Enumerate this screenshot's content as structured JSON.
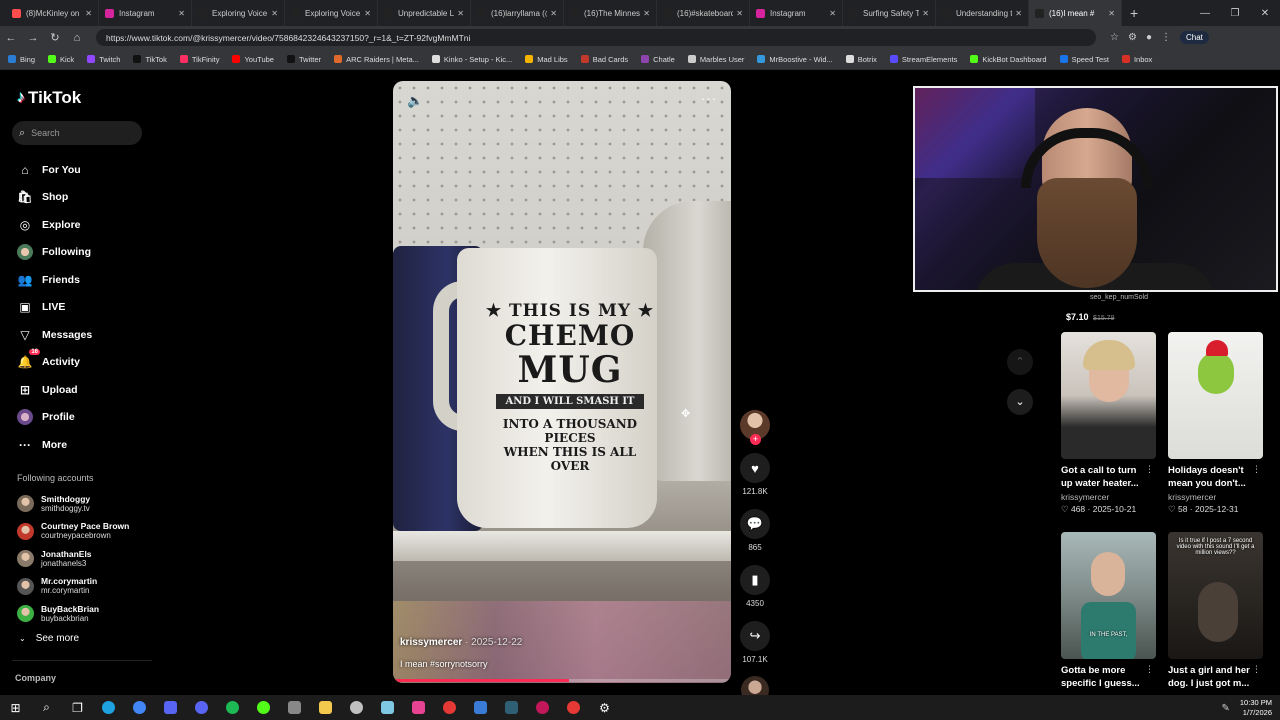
{
  "browser": {
    "tabs": [
      {
        "label": "(8)McKinley on K",
        "color": "#ff4d4d"
      },
      {
        "label": "Instagram",
        "color": "#d6249f"
      },
      {
        "label": "Exploring Voice A",
        "color": "#222222"
      },
      {
        "label": "Exploring Voice A",
        "color": "#222222"
      },
      {
        "label": "Unpredictable Lo",
        "color": "#222222"
      },
      {
        "label": "(16)larryllama (@",
        "color": "#222222"
      },
      {
        "label": "(16)The Minneso",
        "color": "#222222"
      },
      {
        "label": "(16)#skateboardi",
        "color": "#222222"
      },
      {
        "label": "Instagram",
        "color": "#d6249f"
      },
      {
        "label": "Surfing Safety Tip",
        "color": "#222222"
      },
      {
        "label": "Understanding th",
        "color": "#222222"
      },
      {
        "label": "(16)I mean #",
        "color": "#222222"
      }
    ],
    "url": "https://www.tiktok.com/@krissymercer/video/7586842324643237150?_r=1&_t=ZT-92fvgMmMTni",
    "chat_label": "Chat",
    "bookmarks": [
      {
        "label": "Bing",
        "color": "#2b7cd3"
      },
      {
        "label": "Kick",
        "color": "#53fc18"
      },
      {
        "label": "Twitch",
        "color": "#9146ff"
      },
      {
        "label": "TikTok",
        "color": "#111111"
      },
      {
        "label": "TikFinity",
        "color": "#ff2f66"
      },
      {
        "label": "YouTube",
        "color": "#ff0000"
      },
      {
        "label": "Twitter",
        "color": "#111111"
      },
      {
        "label": "ARC Raiders | Meta...",
        "color": "#e06a2b"
      },
      {
        "label": "Kinko - Setup - Kic...",
        "color": "#dddddd"
      },
      {
        "label": "Mad Libs",
        "color": "#f4b400"
      },
      {
        "label": "Bad Cards",
        "color": "#c0392b"
      },
      {
        "label": "Chatle",
        "color": "#8e44ad"
      },
      {
        "label": "Marbles User",
        "color": "#cccccc"
      },
      {
        "label": "MrBoostive - Wid...",
        "color": "#3498db"
      },
      {
        "label": "Botrix",
        "color": "#dddddd"
      },
      {
        "label": "StreamElements",
        "color": "#5a4bff"
      },
      {
        "label": "KickBot Dashboard",
        "color": "#53fc18"
      },
      {
        "label": "Speed Test",
        "color": "#1a73e8"
      },
      {
        "label": "Inbox",
        "color": "#d93025"
      }
    ]
  },
  "tiktok": {
    "logo": "TikTok",
    "search_placeholder": "Search",
    "nav": [
      {
        "label": "For You",
        "icon": "home-icon",
        "glyph": "⌂"
      },
      {
        "label": "Shop",
        "icon": "shop-icon",
        "glyph": "🛍"
      },
      {
        "label": "Explore",
        "icon": "compass-icon",
        "glyph": "◎"
      },
      {
        "label": "Following",
        "icon": "avatar",
        "glyph": ""
      },
      {
        "label": "Friends",
        "icon": "friends-icon",
        "glyph": "👥"
      },
      {
        "label": "LIVE",
        "icon": "live-icon",
        "glyph": "▣"
      },
      {
        "label": "Messages",
        "icon": "messages-icon",
        "glyph": "▽"
      },
      {
        "label": "Activity",
        "icon": "activity-icon",
        "glyph": "🔔",
        "badge": "16"
      },
      {
        "label": "Upload",
        "icon": "upload-icon",
        "glyph": "⊞"
      },
      {
        "label": "Profile",
        "icon": "avatar",
        "glyph": ""
      },
      {
        "label": "More",
        "icon": "more-icon",
        "glyph": "···"
      }
    ],
    "following_title": "Following accounts",
    "following": [
      {
        "name": "Smithdoggy",
        "handle": "smithdoggy.tv",
        "color": "#7a6a5a"
      },
      {
        "name": "Courtney Pace Brown",
        "handle": "courtneypacebrown",
        "color": "#c0392b"
      },
      {
        "name": "JonathanEls",
        "handle": "jonathanels3",
        "color": "#8a7a6a"
      },
      {
        "name": "Mr.corymartin",
        "handle": "mr.corymartin",
        "color": "#555555"
      },
      {
        "name": "BuyBackBrian",
        "handle": "buybackbrian",
        "color": "#3cb043"
      }
    ],
    "see_more": "See more",
    "company": "Company",
    "video": {
      "author": "krissymercer",
      "date": "· 2025-12-22",
      "caption": "I mean #sorrynotsorry",
      "progress": 0.52,
      "mug_line1": "★ THIS IS MY ★",
      "mug_line2": "CHEMO",
      "mug_line3": "MUG",
      "mug_line4": "AND I WILL SMASH IT",
      "mug_line5": "INTO A THOUSAND PIECES",
      "mug_line6": "WHEN THIS IS ALL OVER"
    },
    "actions": {
      "likes": "121.8K",
      "comments": "865",
      "saves": "4350",
      "shares": "107.1K"
    },
    "shop": {
      "name": "seo_kep_numSold",
      "price": "$7.10",
      "old_price": "$15.79"
    },
    "recommended": [
      {
        "title": "Got a call to turn up water heater...",
        "user": "krissymercer",
        "stats": "♡ 468 · 2025-10-21"
      },
      {
        "title": "Holidays doesn't mean you don't...",
        "user": "krissymercer",
        "stats": "♡ 58 · 2025-12-31"
      },
      {
        "title": "Gotta be more specific I guess...",
        "overlay": "IN THE PAST,"
      },
      {
        "title": "Just a girl and her dog. I just got m...",
        "overlay": "Is it true if I post a 7 second video with this sound I'll get a million views??"
      }
    ]
  },
  "taskbar": {
    "time": "10:30 PM",
    "date": "1/7/2026"
  }
}
